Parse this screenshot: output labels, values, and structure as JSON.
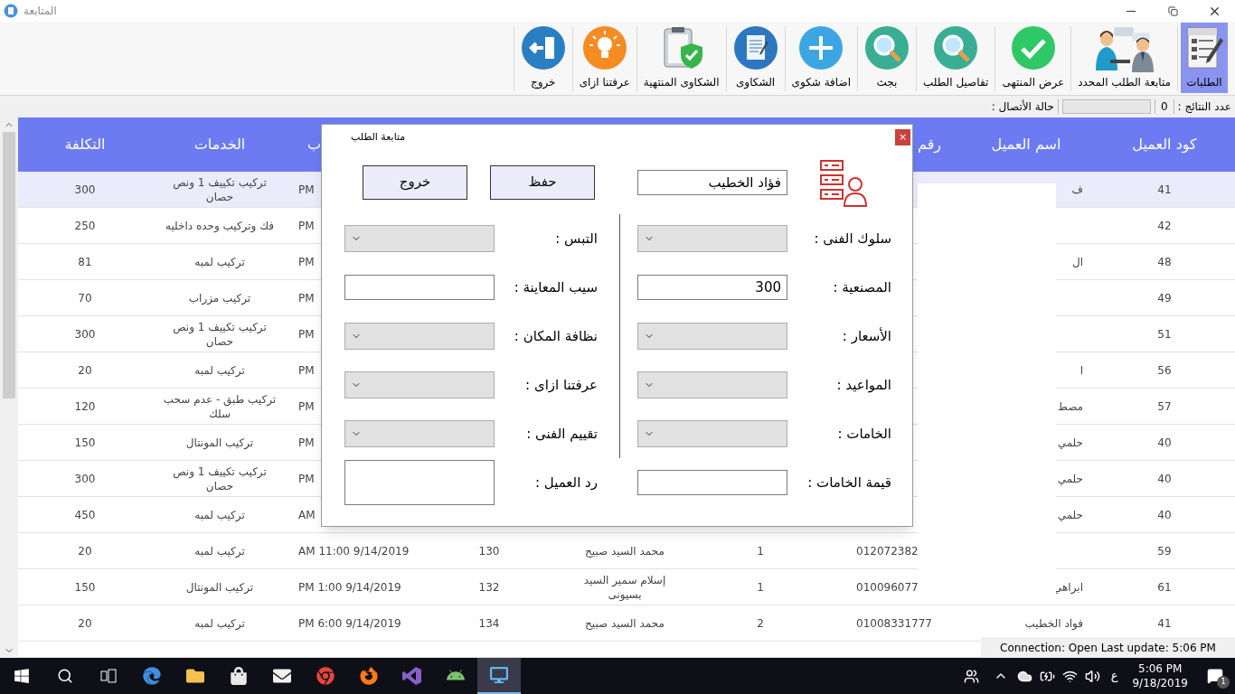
{
  "window": {
    "title": "المتابعة"
  },
  "toolbar": [
    {
      "label": "الطلبات",
      "selected": true
    },
    {
      "label": "متابعة الطلب المحدد",
      "selected": false
    },
    {
      "label": "عرض المنتهى",
      "selected": false
    },
    {
      "label": "تفاصيل الطلب",
      "selected": false
    },
    {
      "label": "بجث",
      "selected": false
    },
    {
      "label": "اضافة شكوى",
      "selected": false
    },
    {
      "label": "الشكاوى",
      "selected": false
    },
    {
      "label": "الشكاوى المنتهية",
      "selected": false
    },
    {
      "label": "عرفتنا ازاى",
      "selected": false
    },
    {
      "label": "خروج",
      "selected": false
    }
  ],
  "status_row": {
    "results_label": "عدد النتائج :",
    "results_count": "0",
    "connection_label": "حالة الأتصال :"
  },
  "table": {
    "columns": {
      "client_code": "كود العميل",
      "client_name": "اسم العميل",
      "column_7": "رقم",
      "column_3": "ب",
      "services": "الخدمات",
      "cost": "التكلفة"
    },
    "rows": [
      {
        "selected": true,
        "client_code": "41",
        "client_name": "ف",
        "column_3": "PM",
        "services": "تركيب تكييف 1 ونص حصان",
        "cost": "300"
      },
      {
        "selected": false,
        "client_code": "42",
        "column_3": "PM",
        "services": "فك وتركيب وحده داخليه",
        "cost": "250"
      },
      {
        "selected": false,
        "client_code": "48",
        "client_name": "ال",
        "column_3": "PM",
        "services": "تركيب لمبه",
        "cost": "81"
      },
      {
        "selected": false,
        "client_code": "49",
        "column_3": "PM",
        "services": "تركيب مزراب",
        "cost": "70"
      },
      {
        "selected": false,
        "client_code": "51",
        "column_3": "PM",
        "services": "تركيب تكييف 1 ونص حصان",
        "cost": "300"
      },
      {
        "selected": false,
        "client_code": "56",
        "client_name": "ا",
        "column_3": "PM",
        "services": "تركيب لمبه",
        "cost": "20"
      },
      {
        "selected": false,
        "client_code": "57",
        "client_name": "مصط",
        "column_3": "PM",
        "services": "تركيب طبق - عدم سحب سلك",
        "cost": "120"
      },
      {
        "selected": false,
        "client_code": "40",
        "client_name": "حلمي",
        "column_3": "PM",
        "services": "تركيب المونتال",
        "cost": "150"
      },
      {
        "selected": false,
        "client_code": "40",
        "client_name": "حلمي",
        "column_3": "PM",
        "services": "تركيب تكييف 1 ونص حصان",
        "cost": "300"
      },
      {
        "selected": false,
        "client_code": "40",
        "client_name": "حلمي",
        "column_3": "AM",
        "services": "تركيب لمبه",
        "cost": "450"
      },
      {
        "selected": false,
        "client_code": "59",
        "column_7": "012072382",
        "column_6": "1",
        "column_5": "محمد السيد صبيح",
        "column_4": "130",
        "column_3": "AM 11:00 9/14/2019",
        "services": "تركيب لمبه",
        "cost": "20"
      },
      {
        "selected": false,
        "client_code": "61",
        "client_name": "ابراهي",
        "column_7": "010096077",
        "column_6": "1",
        "column_5": "إسلام سمير السيد بسيونى",
        "column_4": "132",
        "column_3": "PM 1:00 9/14/2019",
        "services": "تركيب المونتال",
        "cost": "150"
      },
      {
        "selected": false,
        "client_code": "41",
        "client_name": "فواد الخطيب",
        "column_7": "01008331777",
        "column_6": "2",
        "column_5": "محمد السيد صبيح",
        "column_4": "134",
        "column_3": "PM 6:00 9/14/2019",
        "services": "تركيب لمبه",
        "cost": "20"
      }
    ]
  },
  "dialog": {
    "title": "متابعة الطلب",
    "close": "×",
    "name_value": "فؤاد الخطيب",
    "buttons": [
      "حفظ",
      "خروج"
    ],
    "right_fields": [
      {
        "label": "سلوك الفنى :",
        "kind": "combo"
      },
      {
        "label": "المصنعية :",
        "kind": "text",
        "value": "300"
      },
      {
        "label": "الأسعار :",
        "kind": "combo"
      },
      {
        "label": "المواعيد :",
        "kind": "combo"
      },
      {
        "label": "الخامات :",
        "kind": "combo"
      },
      {
        "label": "قيمة الخامات :",
        "kind": "text"
      }
    ],
    "left_fields": [
      {
        "label": "التبس :",
        "kind": "combo"
      },
      {
        "label": "سيب المعاينة :",
        "kind": "text"
      },
      {
        "label": "نظافة المكان :",
        "kind": "combo"
      },
      {
        "label": "عرفتنا ازاى :",
        "kind": "combo"
      },
      {
        "label": "تقييم الفنى :",
        "kind": "combo"
      },
      {
        "label": "رد العميل :",
        "kind": "textarea"
      }
    ]
  },
  "connection_status": "Connection: Open Last update: 5:06 PM",
  "taskbar": {
    "apps": [
      {
        "selected": false
      },
      {
        "selected": false
      },
      {
        "selected": false
      },
      {
        "selected": false
      },
      {
        "selected": false
      },
      {
        "selected": false
      },
      {
        "selected": false
      },
      {
        "selected": false
      },
      {
        "selected": true
      }
    ],
    "language": "ع",
    "time": "5:06 PM",
    "date": "9/18/2019",
    "notifications": "1"
  }
}
